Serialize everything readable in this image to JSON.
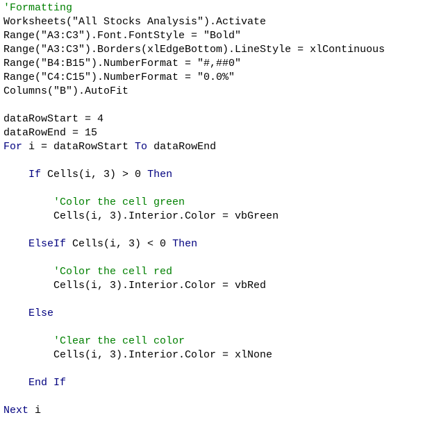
{
  "colors": {
    "background": "#ffffff",
    "plain": "#000000",
    "comment": "#008000",
    "keyword": "#00007f"
  },
  "code": {
    "lines": [
      [
        {
          "t": "comment",
          "v": "'Formatting"
        }
      ],
      [
        {
          "t": "plain",
          "v": "Worksheets(\"All Stocks Analysis\").Activate"
        }
      ],
      [
        {
          "t": "plain",
          "v": "Range(\"A3:C3\").Font.FontStyle = \"Bold\""
        }
      ],
      [
        {
          "t": "plain",
          "v": "Range(\"A3:C3\").Borders(xlEdgeBottom).LineStyle = xlContinuous"
        }
      ],
      [
        {
          "t": "plain",
          "v": "Range(\"B4:B15\").NumberFormat = \"#,##0\""
        }
      ],
      [
        {
          "t": "plain",
          "v": "Range(\"C4:C15\").NumberFormat = \"0.0%\""
        }
      ],
      [
        {
          "t": "plain",
          "v": "Columns(\"B\").AutoFit"
        }
      ],
      [],
      [
        {
          "t": "plain",
          "v": "dataRowStart = 4"
        }
      ],
      [
        {
          "t": "plain",
          "v": "dataRowEnd = 15"
        }
      ],
      [
        {
          "t": "keyword",
          "v": "For"
        },
        {
          "t": "plain",
          "v": " i = dataRowStart "
        },
        {
          "t": "keyword",
          "v": "To"
        },
        {
          "t": "plain",
          "v": " dataRowEnd"
        }
      ],
      [],
      [
        {
          "t": "plain",
          "v": "    "
        },
        {
          "t": "keyword",
          "v": "If"
        },
        {
          "t": "plain",
          "v": " Cells(i, 3) > 0 "
        },
        {
          "t": "keyword",
          "v": "Then"
        }
      ],
      [],
      [
        {
          "t": "plain",
          "v": "        "
        },
        {
          "t": "comment",
          "v": "'Color the cell green"
        }
      ],
      [
        {
          "t": "plain",
          "v": "        Cells(i, 3).Interior.Color = vbGreen"
        }
      ],
      [],
      [
        {
          "t": "plain",
          "v": "    "
        },
        {
          "t": "keyword",
          "v": "ElseIf"
        },
        {
          "t": "plain",
          "v": " Cells(i, 3) < 0 "
        },
        {
          "t": "keyword",
          "v": "Then"
        }
      ],
      [],
      [
        {
          "t": "plain",
          "v": "        "
        },
        {
          "t": "comment",
          "v": "'Color the cell red"
        }
      ],
      [
        {
          "t": "plain",
          "v": "        Cells(i, 3).Interior.Color = vbRed"
        }
      ],
      [],
      [
        {
          "t": "plain",
          "v": "    "
        },
        {
          "t": "keyword",
          "v": "Else"
        }
      ],
      [],
      [
        {
          "t": "plain",
          "v": "        "
        },
        {
          "t": "comment",
          "v": "'Clear the cell color"
        }
      ],
      [
        {
          "t": "plain",
          "v": "        Cells(i, 3).Interior.Color = xlNone"
        }
      ],
      [],
      [
        {
          "t": "plain",
          "v": "    "
        },
        {
          "t": "keyword",
          "v": "End If"
        }
      ],
      [],
      [
        {
          "t": "keyword",
          "v": "Next"
        },
        {
          "t": "plain",
          "v": " i"
        }
      ]
    ]
  }
}
